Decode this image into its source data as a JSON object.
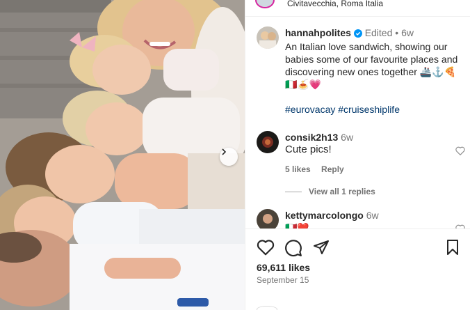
{
  "location": {
    "text": "Civitavecchia, Roma Italia"
  },
  "caption": {
    "username": "hannahpolites",
    "edited": "Edited",
    "separator": "•",
    "time": "6w",
    "text": "An Italian love sandwich, showing our babies some of our favourite places and discovering new ones together 🚢⚓️🍕",
    "text_line2": "🇮🇹🍝💗",
    "hashtags": "#eurovacay #cruiseshiplife"
  },
  "comments": [
    {
      "username": "consik2h13",
      "time": "6w",
      "text": "Cute pics!",
      "likes": "5 likes",
      "reply": "Reply",
      "view_replies": "View all 1 replies"
    },
    {
      "username": "kettymarcolongo",
      "time": "6w",
      "text": "🇮🇹❤️"
    }
  ],
  "actions": {
    "likes": "69,611 likes",
    "date": "September 15"
  },
  "icons": {
    "like": "heart-icon",
    "comment": "comment-icon",
    "share": "share-icon",
    "save": "bookmark-icon",
    "next": "chevron-right-icon",
    "verified": "verified-badge-icon"
  },
  "colors": {
    "link": "#00376b",
    "verified": "#0095f6",
    "muted": "#737373"
  }
}
